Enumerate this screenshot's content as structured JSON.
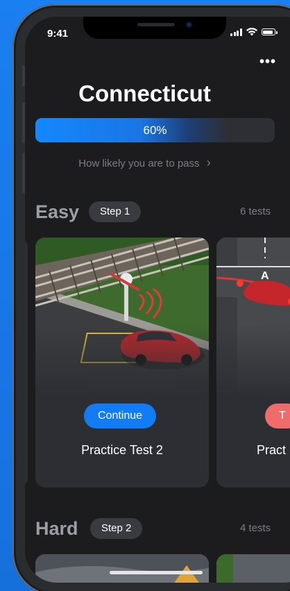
{
  "status_bar": {
    "time": "9:41"
  },
  "header": {
    "more_label": "•••",
    "title": "Connecticut"
  },
  "progress": {
    "value": 0.6,
    "label": "60%",
    "likely_text": "How likely you are to pass",
    "chevron": "›"
  },
  "sections": [
    {
      "title": "Easy",
      "step": "Step 1",
      "count": "6 tests"
    },
    {
      "title": "Hard",
      "step": "Step 2",
      "count": "4 tests"
    }
  ],
  "cards": [
    {
      "button": "Continue",
      "title": "Practice Test 2"
    },
    {
      "button": "T",
      "title": "Pract"
    }
  ],
  "colors": {
    "accent": "#1488ff",
    "continue": "#127cf7",
    "start": "#f06b6b",
    "background": "#1c1c1e"
  }
}
